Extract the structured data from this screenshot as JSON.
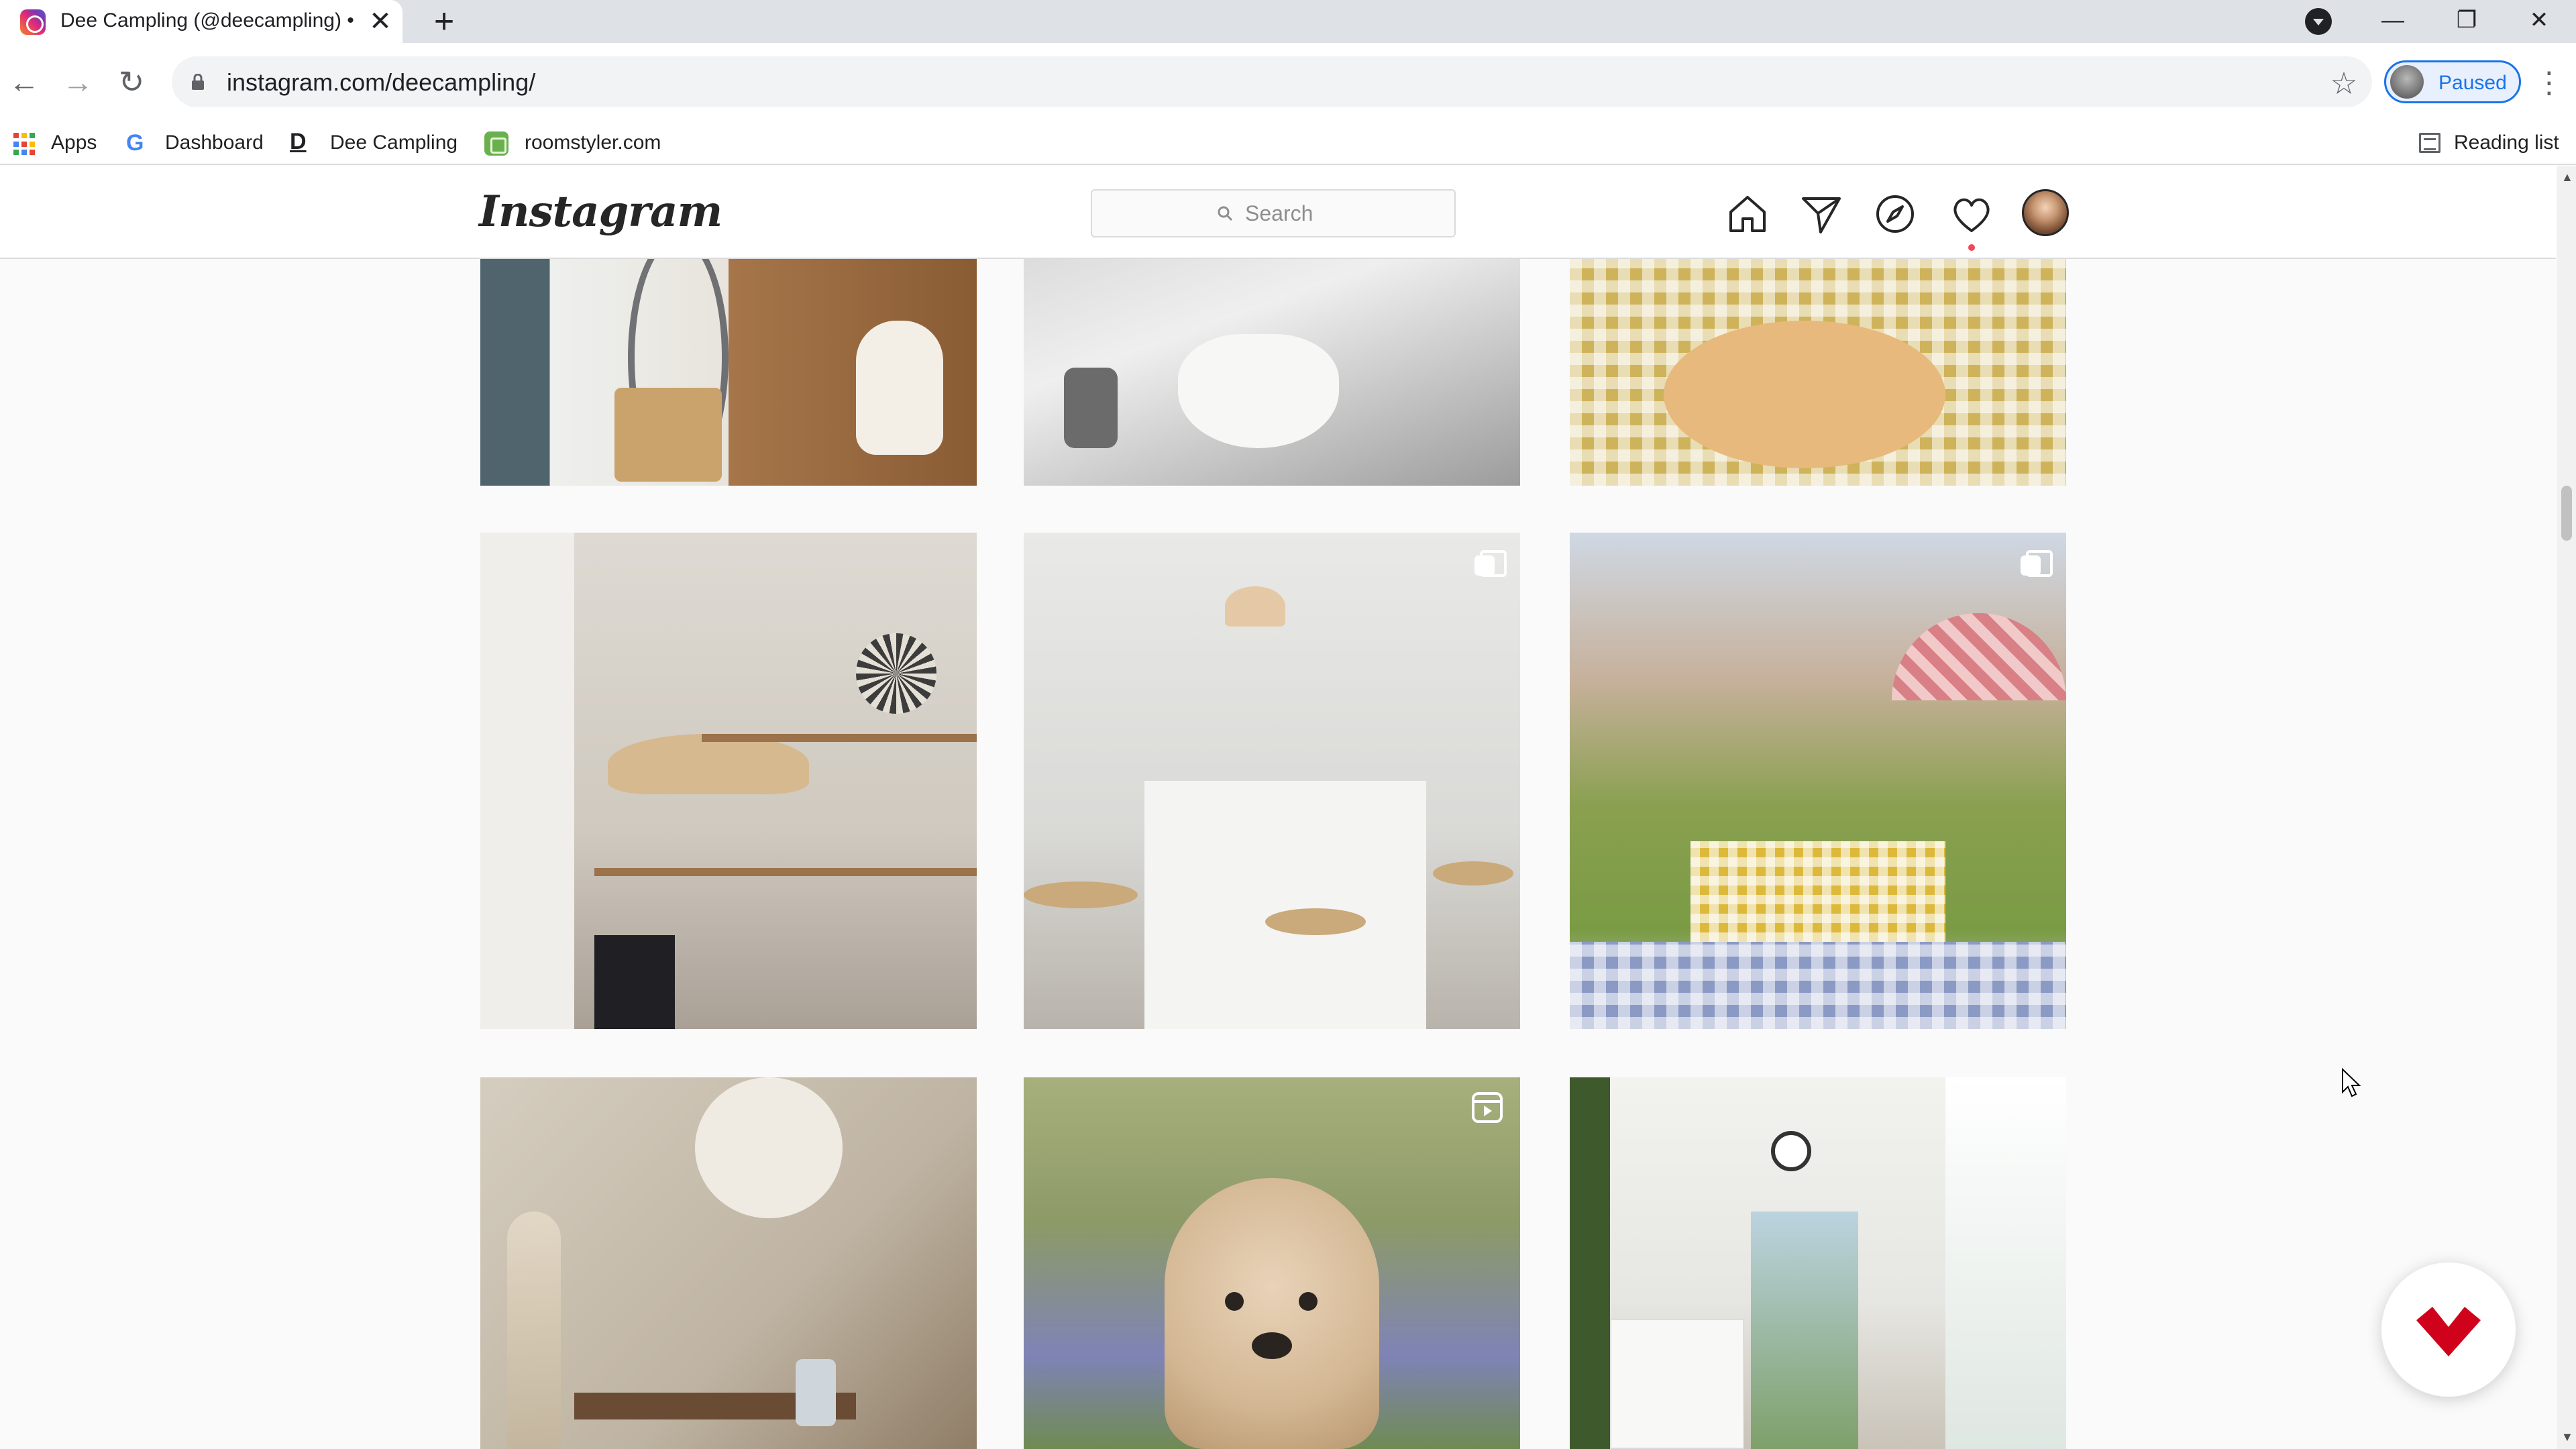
{
  "browser": {
    "tab": {
      "title": "Dee Campling (@deecampling) •",
      "favicon": "instagram-icon"
    },
    "new_tab_label": "+",
    "window_controls": {
      "minimize": "—",
      "restore": "❐",
      "close": "✕"
    },
    "nav": {
      "back": "←",
      "forward": "→",
      "reload": "↻"
    },
    "url": "instagram.com/deecampling/",
    "bookmark_star": "☆",
    "profile_status": "Paused",
    "menu": "⋮",
    "bookmarks": [
      {
        "label": "Apps",
        "icon": "apps-grid-icon"
      },
      {
        "label": "Dashboard",
        "icon": "google-icon"
      },
      {
        "label": "Dee Campling",
        "icon": "d-logo-icon"
      },
      {
        "label": "roomstyler.com",
        "icon": "roomstyler-icon"
      }
    ],
    "reading_list": "Reading list",
    "colors": {
      "tab_strip": "#dee1e6",
      "accent": "#1a73e8"
    }
  },
  "instagram": {
    "logo": "Instagram",
    "search_placeholder": "Search",
    "nav_icons": [
      "home-icon",
      "direct-message-icon",
      "explore-icon",
      "activity-heart-icon",
      "profile-avatar"
    ],
    "notification_color": "#ed4956",
    "posts": [
      {
        "subject": "hallway with bicycle and white dog",
        "overlay": ""
      },
      {
        "subject": "table with bowl of eggs",
        "overlay": ""
      },
      {
        "subject": "gingham picnic table with flower pizza",
        "overlay": ""
      },
      {
        "subject": "kitchen shelves with rattan lamp",
        "overlay": ""
      },
      {
        "subject": "white kitchen island with stools",
        "overlay": "carousel-icon"
      },
      {
        "subject": "garden picnic with pink gingham umbrella",
        "overlay": "carousel-icon"
      },
      {
        "subject": "paper lamp with pampas grass",
        "overlay": ""
      },
      {
        "subject": "dog in bluebell woods",
        "overlay": "reel-icon"
      },
      {
        "subject": "white hallway with clock and plants",
        "overlay": ""
      }
    ]
  }
}
